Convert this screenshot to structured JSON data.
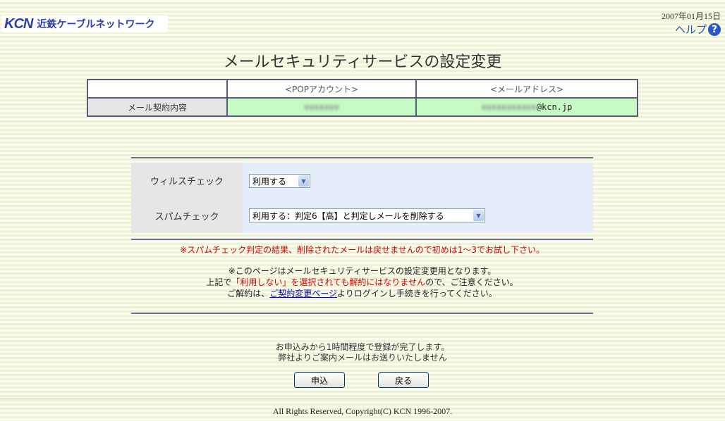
{
  "header": {
    "logo_mark": "KCN",
    "logo_text": "近鉄ケーブルネットワーク",
    "date": "2007年01月15日",
    "help_label": "ヘルプ",
    "help_icon": "question-circle-icon"
  },
  "page_title": "メールセキュリティサービスの設定変更",
  "contract": {
    "col_pop": "<POPアカウント>",
    "col_mail": "<メールアドレス>",
    "row_label": "メール契約内容",
    "pop_value": "xxxxxxx",
    "mail_value_hidden": "xxxxxxxxxxx",
    "mail_domain": "@kcn.jp"
  },
  "settings": {
    "virus_label": "ウィルスチェック",
    "virus_value": "利用する",
    "spam_label": "スパムチェック",
    "spam_value": "利用する：判定6【高】と判定しメールを削除する"
  },
  "warning": "※スパムチェック判定の結果、削除されたメールは戻せませんので初めは1～3でお試し下さい。",
  "notes": {
    "line1": "※このページはメールセキュリティサービスの設定変更用となります。",
    "line2_pre": "上記で",
    "line2_red": "「利用しない」を選択されても解約にはなりません",
    "line2_post": "ので、ご注意ください。",
    "line3_pre": "ご解約は、",
    "line3_link": "ご契約変更ページ",
    "line3_post": "よりログインし手続きを行ってください。"
  },
  "info": {
    "line1": "お申込みから1時間程度で登録が完了します。",
    "line2": "弊社よりご案内メールはお送りいたしません"
  },
  "buttons": {
    "apply": "申込",
    "back": "戻る"
  },
  "footer": "All Rights Reserved, Copyright(C) KCN 1996-2007."
}
